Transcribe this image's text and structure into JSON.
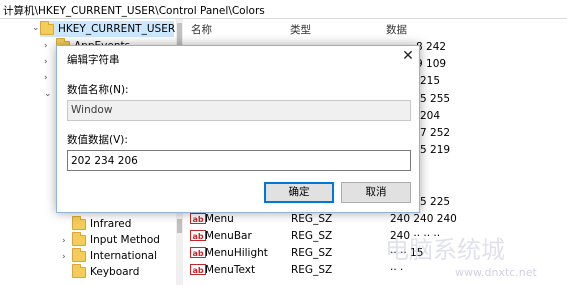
{
  "address_bar": "计算机\\HKEY_CURRENT_USER\\Control Panel\\Colors",
  "tree": {
    "root_key": "HKEY_CURRENT_USER",
    "visible_partial": "AppEvents",
    "items": [
      "Infrared",
      "Input Method",
      "International",
      "Keyboard"
    ]
  },
  "list": {
    "columns": {
      "name": "名称",
      "type": "类型",
      "data": "数据"
    },
    "hidden_data_fragments": [
      "8 242",
      "9 109",
      "215",
      "5 255",
      "204",
      "7 252",
      "5 219",
      "5 225"
    ],
    "rows": [
      {
        "name": "Menu",
        "type": "REG_SZ",
        "data": "240 240 240"
      },
      {
        "name": "MenuBar",
        "type": "REG_SZ",
        "data": "240 ·· ·· ··"
      },
      {
        "name": "MenuHilight",
        "type": "REG_SZ",
        "data": "·· ·· 15"
      },
      {
        "name": "MenuText",
        "type": "REG_SZ",
        "data": "·· ·"
      }
    ]
  },
  "dialog": {
    "title": "编辑字符串",
    "name_label": "数值名称(N):",
    "name_value": "Window",
    "data_label": "数值数据(V):",
    "data_value": "202 234 206",
    "ok_label": "确定",
    "cancel_label": "取消"
  },
  "watermark": {
    "logo": "电脑系统城",
    "url": "www.dnxtc.net"
  },
  "icons": {
    "close": "close-icon",
    "folder": "folder-icon",
    "string_value": "ab-icon"
  }
}
